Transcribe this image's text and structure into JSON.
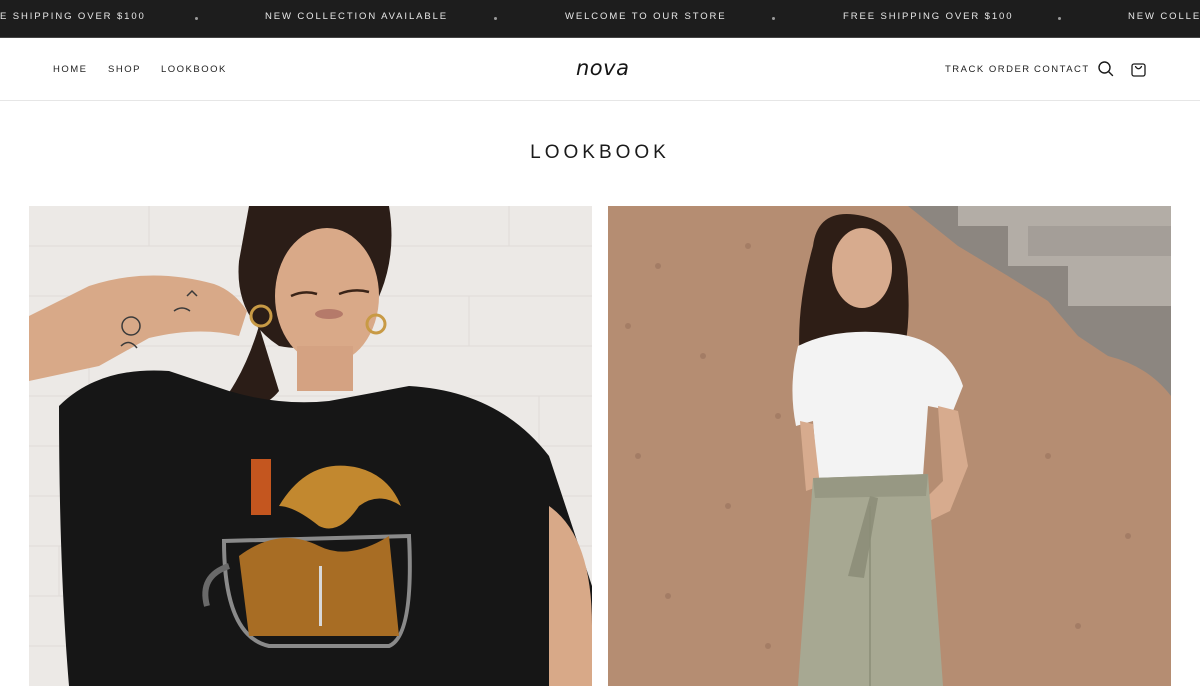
{
  "announcement_bar": {
    "messages": [
      "E SHIPPING OVER $100",
      "NEW COLLECTION AVAILABLE",
      "WELCOME TO OUR STORE",
      "FREE SHIPPING OVER $100",
      "NEW COLLEC"
    ]
  },
  "header": {
    "logo": "nova",
    "nav_left": [
      "HOME",
      "SHOP",
      "LOOKBOOK"
    ],
    "nav_right": [
      "TRACK ORDER",
      "CONTACT"
    ],
    "icons": [
      "search-icon",
      "cart-icon"
    ]
  },
  "main": {
    "title": "LOOKBOOK",
    "images": [
      "lookbook-image-graphic-tee",
      "lookbook-image-white-tee-linen-pants"
    ]
  },
  "colors": {
    "announcement_bg": "#1d1d1d",
    "announcement_text": "#e8e8e8",
    "text": "#1a1a1a",
    "background": "#ffffff"
  }
}
